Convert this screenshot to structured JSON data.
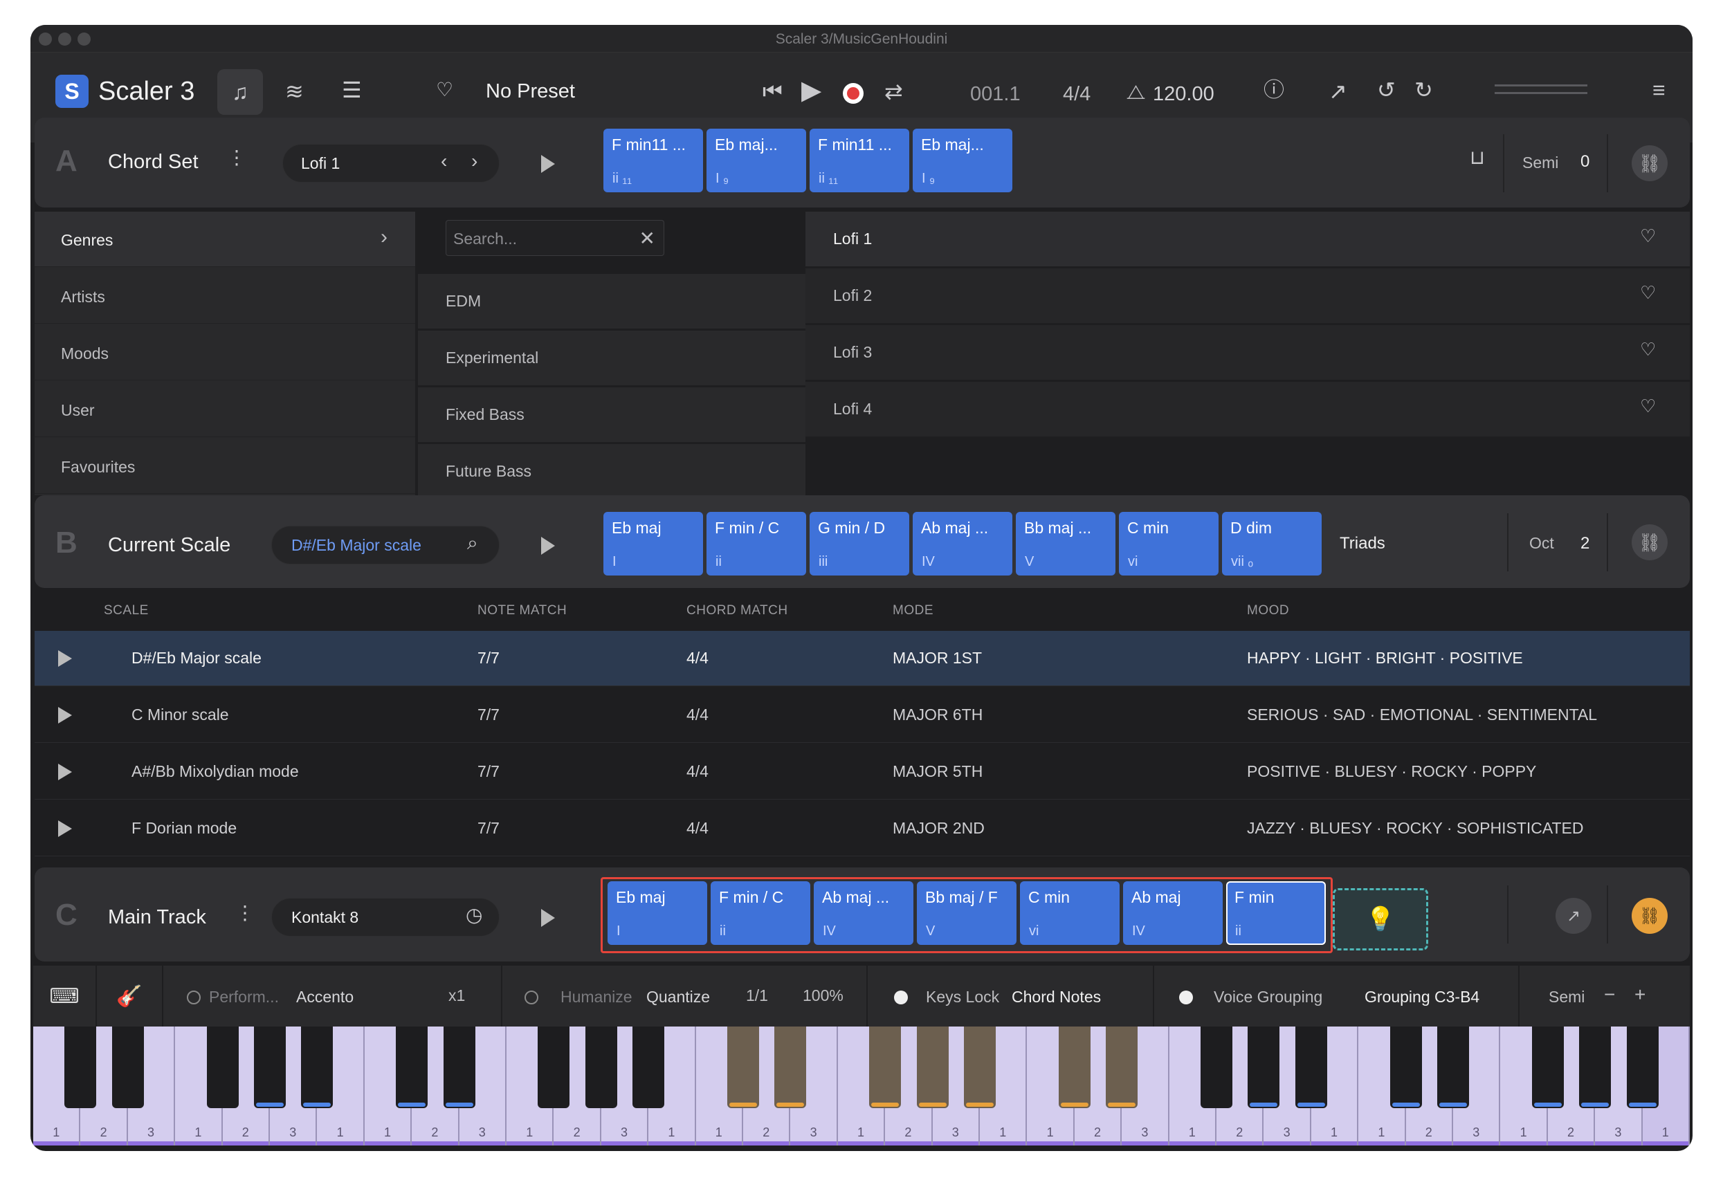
{
  "window": {
    "title": "Scaler 3/MusicGenHoudini"
  },
  "app": {
    "name": "Scaler 3",
    "preset": "No Preset",
    "position": "001.1",
    "time_sig": "4/4",
    "tempo": "120.00"
  },
  "colors": {
    "accent": "#3f72d9",
    "highlight_border": "#e5443a",
    "gold": "#e8a13b"
  },
  "section_a": {
    "letter": "A",
    "title": "Chord Set",
    "preset": "Lofi 1",
    "semi_label": "Semi",
    "semi_value": "0",
    "chords": [
      {
        "name": "F min11 ...",
        "degree": "ii ₁₁"
      },
      {
        "name": "Eb maj...",
        "degree": "I ₉"
      },
      {
        "name": "F min11 ...",
        "degree": "ii ₁₁"
      },
      {
        "name": "Eb maj...",
        "degree": "I ₉"
      }
    ]
  },
  "browser": {
    "categories": [
      "Genres",
      "Artists",
      "Moods",
      "User",
      "Favourites"
    ],
    "search_placeholder": "Search...",
    "genres": [
      "EDM",
      "Experimental",
      "Fixed Bass",
      "Future Bass"
    ],
    "presets": [
      "Lofi 1",
      "Lofi 2",
      "Lofi 3",
      "Lofi 4"
    ]
  },
  "section_b": {
    "letter": "B",
    "title": "Current Scale",
    "scale": "D#/Eb Major scale",
    "mode_label": "Triads",
    "oct_label": "Oct",
    "oct_value": "2",
    "chords": [
      {
        "name": "Eb maj",
        "degree": "I"
      },
      {
        "name": "F min / C",
        "degree": "ii"
      },
      {
        "name": "G min / D",
        "degree": "iii"
      },
      {
        "name": "Ab maj ...",
        "degree": "IV"
      },
      {
        "name": "Bb maj ...",
        "degree": "V"
      },
      {
        "name": "C min",
        "degree": "vi"
      },
      {
        "name": "D dim",
        "degree": "vii ₒ"
      }
    ]
  },
  "scale_table": {
    "headers": [
      "SCALE",
      "NOTE MATCH",
      "CHORD MATCH",
      "MODE",
      "MOOD"
    ],
    "rows": [
      {
        "scale": "D#/Eb Major scale",
        "note": "7/7",
        "chord": "4/4",
        "mode": "MAJOR  1ST",
        "mood": "HAPPY  ·  LIGHT  ·  BRIGHT  ·  POSITIVE"
      },
      {
        "scale": "C Minor scale",
        "note": "7/7",
        "chord": "4/4",
        "mode": "MAJOR  6TH",
        "mood": "SERIOUS  ·  SAD  ·  EMOTIONAL  ·  SENTIMENTAL"
      },
      {
        "scale": "A#/Bb Mixolydian mode",
        "note": "7/7",
        "chord": "4/4",
        "mode": "MAJOR  5TH",
        "mood": "POSITIVE  ·  BLUESY  ·  ROCKY  ·  POPPY"
      },
      {
        "scale": "F Dorian mode",
        "note": "7/7",
        "chord": "4/4",
        "mode": "MAJOR  2ND",
        "mood": "JAZZY  ·  BLUESY  ·  ROCKY  ·  SOPHISTICATED"
      }
    ]
  },
  "section_c": {
    "letter": "C",
    "title": "Main Track",
    "instrument": "Kontakt 8",
    "chords": [
      {
        "name": "Eb maj",
        "degree": "I"
      },
      {
        "name": "F min / C",
        "degree": "ii"
      },
      {
        "name": "Ab maj ...",
        "degree": "IV"
      },
      {
        "name": "Bb maj / F",
        "degree": "V"
      },
      {
        "name": "C min",
        "degree": "vi"
      },
      {
        "name": "Ab maj",
        "degree": "IV"
      },
      {
        "name": "F min",
        "degree": "ii"
      }
    ]
  },
  "bottombar": {
    "perform": "Perform...",
    "accento": "Accento",
    "x1": "x1",
    "humanize": "Humanize",
    "quantize": "Quantize",
    "q_div": "1/1",
    "q_pct": "100%",
    "keys_lock": "Keys Lock",
    "chord_notes": "Chord Notes",
    "voice_grouping": "Voice Grouping",
    "grouping": "Grouping C3-B4",
    "semi": "Semi",
    "minus": "−",
    "plus": "+"
  },
  "keyboard": {
    "fingering": [
      "1",
      "2",
      "3",
      "1",
      "2",
      "3",
      "1",
      "1",
      "2",
      "3",
      "1",
      "2",
      "3",
      "1",
      "1",
      "2",
      "3",
      "1",
      "2",
      "3",
      "1",
      "1",
      "2",
      "3",
      "1",
      "2",
      "3",
      "1",
      "1",
      "2",
      "3",
      "1",
      "2",
      "3",
      "1"
    ]
  }
}
